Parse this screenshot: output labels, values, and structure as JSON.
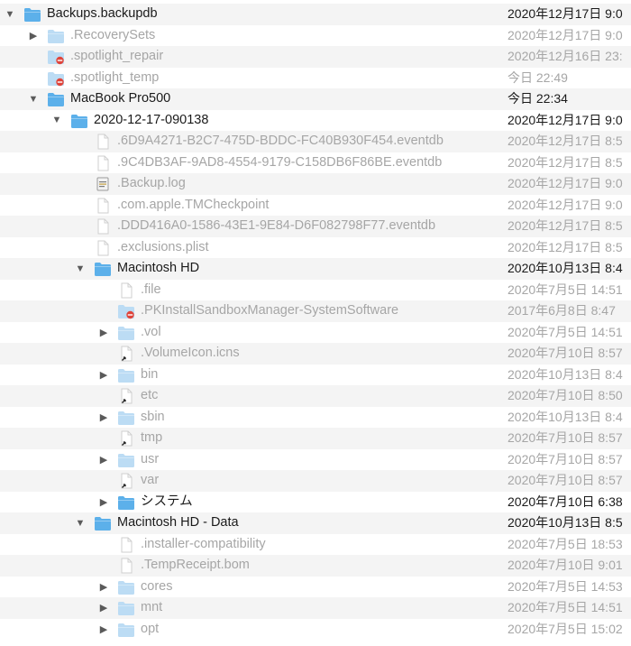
{
  "colors": {
    "folder": "#5cb0ea",
    "folder_dim": "#bcdcf4",
    "row_alt": "#f4f4f4",
    "text": "#1a1a1a",
    "text_dim": "#a6a6a6",
    "badge": "#e0443a"
  },
  "rows": [
    {
      "depth": 0,
      "tri": "down",
      "icon": "folder",
      "name": "Backups.backupdb",
      "date": "2020年12月17日 9:0",
      "dim": false
    },
    {
      "depth": 1,
      "tri": "right",
      "icon": "folder",
      "name": ".RecoverySets",
      "date": "2020年12月17日 9:0",
      "dim": true
    },
    {
      "depth": 1,
      "tri": "none",
      "icon": "folder-badge",
      "name": ".spotlight_repair",
      "date": "2020年12月16日 23:",
      "dim": true
    },
    {
      "depth": 1,
      "tri": "none",
      "icon": "folder-badge",
      "name": ".spotlight_temp",
      "date": "今日 22:49",
      "dim": true
    },
    {
      "depth": 1,
      "tri": "down",
      "icon": "folder",
      "name": "MacBook Pro500",
      "date": "今日 22:34",
      "dim": false
    },
    {
      "depth": 2,
      "tri": "down",
      "icon": "folder",
      "name": "2020-12-17-090138",
      "date": "2020年12月17日 9:0",
      "dim": false
    },
    {
      "depth": 3,
      "tri": "none",
      "icon": "doc",
      "name": ".6D9A4271-B2C7-475D-BDDC-FC40B930F454.eventdb",
      "date": "2020年12月17日 8:5",
      "dim": true
    },
    {
      "depth": 3,
      "tri": "none",
      "icon": "doc",
      "name": ".9C4DB3AF-9AD8-4554-9179-C158DB6F86BE.eventdb",
      "date": "2020年12月17日 8:5",
      "dim": true
    },
    {
      "depth": 3,
      "tri": "none",
      "icon": "log",
      "name": ".Backup.log",
      "date": "2020年12月17日 9:0",
      "dim": true
    },
    {
      "depth": 3,
      "tri": "none",
      "icon": "doc",
      "name": ".com.apple.TMCheckpoint",
      "date": "2020年12月17日 9:0",
      "dim": true
    },
    {
      "depth": 3,
      "tri": "none",
      "icon": "doc",
      "name": ".DDD416A0-1586-43E1-9E84-D6F082798F77.eventdb",
      "date": "2020年12月17日 8:5",
      "dim": true
    },
    {
      "depth": 3,
      "tri": "none",
      "icon": "doc",
      "name": ".exclusions.plist",
      "date": "2020年12月17日 8:5",
      "dim": true
    },
    {
      "depth": 3,
      "tri": "down",
      "icon": "folder",
      "name": "Macintosh HD",
      "date": "2020年10月13日 8:4",
      "dim": false
    },
    {
      "depth": 4,
      "tri": "none",
      "icon": "doc",
      "name": ".file",
      "date": "2020年7月5日 14:51",
      "dim": true
    },
    {
      "depth": 4,
      "tri": "none",
      "icon": "folder-badge",
      "name": ".PKInstallSandboxManager-SystemSoftware",
      "date": "2017年6月8日 8:47",
      "dim": true
    },
    {
      "depth": 4,
      "tri": "right",
      "icon": "folder",
      "name": ".vol",
      "date": "2020年7月5日 14:51",
      "dim": true
    },
    {
      "depth": 4,
      "tri": "none",
      "icon": "alias",
      "name": ".VolumeIcon.icns",
      "date": "2020年7月10日 8:57",
      "dim": true
    },
    {
      "depth": 4,
      "tri": "right",
      "icon": "folder",
      "name": "bin",
      "date": "2020年10月13日 8:4",
      "dim": true
    },
    {
      "depth": 4,
      "tri": "none",
      "icon": "alias",
      "name": "etc",
      "date": "2020年7月10日 8:50",
      "dim": true
    },
    {
      "depth": 4,
      "tri": "right",
      "icon": "folder",
      "name": "sbin",
      "date": "2020年10月13日 8:4",
      "dim": true
    },
    {
      "depth": 4,
      "tri": "none",
      "icon": "alias",
      "name": "tmp",
      "date": "2020年7月10日 8:57",
      "dim": true
    },
    {
      "depth": 4,
      "tri": "right",
      "icon": "folder",
      "name": "usr",
      "date": "2020年7月10日 8:57",
      "dim": true
    },
    {
      "depth": 4,
      "tri": "none",
      "icon": "alias",
      "name": "var",
      "date": "2020年7月10日 8:57",
      "dim": true
    },
    {
      "depth": 4,
      "tri": "right",
      "icon": "folder",
      "name": "システム",
      "date": "2020年7月10日 6:38",
      "dim": false
    },
    {
      "depth": 3,
      "tri": "down",
      "icon": "folder",
      "name": "Macintosh HD - Data",
      "date": "2020年10月13日 8:5",
      "dim": false
    },
    {
      "depth": 4,
      "tri": "none",
      "icon": "doc",
      "name": ".installer-compatibility",
      "date": "2020年7月5日 18:53",
      "dim": true
    },
    {
      "depth": 4,
      "tri": "none",
      "icon": "doc",
      "name": ".TempReceipt.bom",
      "date": "2020年7月10日 9:01",
      "dim": true
    },
    {
      "depth": 4,
      "tri": "right",
      "icon": "folder",
      "name": "cores",
      "date": "2020年7月5日 14:53",
      "dim": true
    },
    {
      "depth": 4,
      "tri": "right",
      "icon": "folder",
      "name": "mnt",
      "date": "2020年7月5日 14:51",
      "dim": true
    },
    {
      "depth": 4,
      "tri": "right",
      "icon": "folder",
      "name": "opt",
      "date": "2020年7月5日 15:02",
      "dim": true
    }
  ]
}
